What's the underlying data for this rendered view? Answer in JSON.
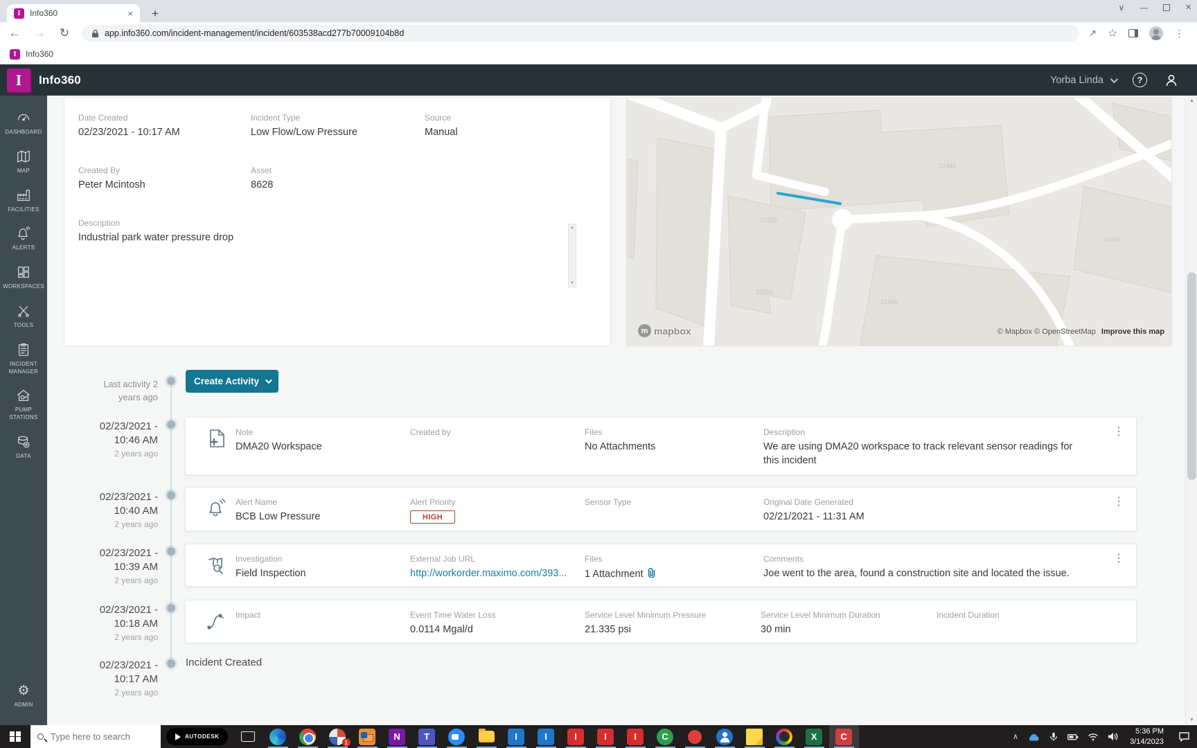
{
  "browser": {
    "tab_title": "Info360",
    "url": "app.info360.com/incident-management/incident/603538acd277b70009104b8d",
    "bookmark": "Info360"
  },
  "header": {
    "app_name": "Info360",
    "location": "Yorba Linda",
    "logo_letter": "I"
  },
  "sidebar": {
    "items": [
      {
        "label": "DASHBOARD",
        "icon": "gauge-icon"
      },
      {
        "label": "MAP",
        "icon": "map-icon"
      },
      {
        "label": "FACILITIES",
        "icon": "factory-icon"
      },
      {
        "label": "ALERTS",
        "icon": "bell-icon"
      },
      {
        "label": "WORKSPACES",
        "icon": "grid-icon"
      },
      {
        "label": "TOOLS",
        "icon": "tools-icon"
      },
      {
        "label": "INCIDENT MANAGER",
        "icon": "clipboard-icon"
      },
      {
        "label": "PUMP STATIONS",
        "icon": "pump-icon"
      },
      {
        "label": "DATA",
        "icon": "database-icon"
      },
      {
        "label": "ADMIN",
        "icon": "gear-icon"
      }
    ]
  },
  "incident": {
    "fields": [
      {
        "label": "Date Created",
        "value": "02/23/2021 - 10:17 AM"
      },
      {
        "label": "Incident Type",
        "value": "Low Flow/Low Pressure"
      },
      {
        "label": "Source",
        "value": "Manual"
      },
      {
        "label": "Created By",
        "value": "Peter Mcintosh"
      },
      {
        "label": "Asset",
        "value": "8628"
      },
      {
        "label": "Description",
        "value": "Industrial park water pressure drop"
      }
    ]
  },
  "map": {
    "logo_text": "mapbox",
    "attribution": "© Mapbox © OpenStreetMap",
    "improve_link": "Improve this map",
    "labels": [
      "22448",
      "22435",
      "22425",
      "22465",
      "22445"
    ],
    "highlight_color": "#2ba7cd"
  },
  "timeline": {
    "last_activity": "Last activity 2 years ago",
    "create_activity_label": "Create Activity",
    "entries": [
      {
        "type": "note",
        "date": "02/23/2021 -",
        "time": "10:46 AM",
        "ago": "2 years ago",
        "fields": [
          {
            "label": "Note",
            "value": "DMA20 Workspace"
          },
          {
            "label": "Created by",
            "value": ""
          },
          {
            "label": "Files",
            "value": "No Attachments"
          },
          {
            "label": "Description",
            "value": "We are using DMA20 workspace to track relevant sensor readings for this incident"
          }
        ]
      },
      {
        "type": "alert",
        "date": "02/23/2021 -",
        "time": "10:40 AM",
        "ago": "2 years ago",
        "fields": [
          {
            "label": "Alert Name",
            "value": "BCB Low Pressure"
          },
          {
            "label": "Alert Priority",
            "value": "HIGH"
          },
          {
            "label": "Sensor Type",
            "value": ""
          },
          {
            "label": "Original Date Generated",
            "value": "02/21/2021 - 11:31 AM"
          }
        ]
      },
      {
        "type": "investigation",
        "date": "02/23/2021 -",
        "time": "10:39 AM",
        "ago": "2 years ago",
        "fields": [
          {
            "label": "Investigation",
            "value": "Field Inspection"
          },
          {
            "label": "External Job URL",
            "value": "http://workorder.maximo.com/393..."
          },
          {
            "label": "Files",
            "value": "1 Attachment"
          },
          {
            "label": "Comments",
            "value": "Joe went to the area, found a construction site and located the issue."
          }
        ]
      },
      {
        "type": "impact",
        "date": "02/23/2021 -",
        "time": "10:18 AM",
        "ago": "2 years ago",
        "fields": [
          {
            "label": "Impact",
            "value": ""
          },
          {
            "label": "Event Time Water Loss",
            "value": "0.0114 Mgal/d"
          },
          {
            "label": "Service Level Minimum Pressure",
            "value": "21.335 psi"
          },
          {
            "label": "Service Level Minimum Duration",
            "value": "30 min"
          },
          {
            "label": "Incident Duration",
            "value": ""
          }
        ]
      },
      {
        "type": "created",
        "date": "02/23/2021 -",
        "time": "10:17 AM",
        "ago": "2 years ago",
        "text": "Incident Created"
      }
    ]
  },
  "taskbar": {
    "search_placeholder": "Type here to search",
    "autodesk_label": "AUTODESK",
    "time": "5:36 PM",
    "date": "3/14/2023",
    "apps": [
      {
        "name": "task-view"
      },
      {
        "name": "edge"
      },
      {
        "name": "chrome"
      },
      {
        "name": "notifications",
        "badge": "1"
      },
      {
        "name": "outlook"
      },
      {
        "name": "onenote",
        "letter": "N"
      },
      {
        "name": "teams",
        "letter": "T"
      },
      {
        "name": "zoom"
      },
      {
        "name": "file-explorer"
      },
      {
        "name": "info360-blue-1",
        "letter": "I"
      },
      {
        "name": "info360-blue-2",
        "letter": "I"
      },
      {
        "name": "info360-red-1",
        "letter": "I"
      },
      {
        "name": "info360-red-2",
        "letter": "I"
      },
      {
        "name": "info360-red-3",
        "letter": "I"
      },
      {
        "name": "camtasia-green",
        "letter": "C"
      },
      {
        "name": "recorder-dot"
      },
      {
        "name": "contacts"
      },
      {
        "name": "sticky-notes"
      },
      {
        "name": "adobe-cc"
      },
      {
        "name": "excel",
        "letter": "X"
      },
      {
        "name": "camtasia",
        "letter": "C",
        "active": true
      }
    ]
  },
  "icons": {
    "close": "×",
    "new_tab": "+",
    "tab_search": "∨",
    "minimize": "—",
    "kebab": "⋮",
    "star": "☆",
    "back": "←",
    "forward": "→",
    "reload": "↻",
    "chevron_up": "∧",
    "caret_up": "▲",
    "caret_down": "▼",
    "gear": "⚙",
    "question": "?",
    "share": "↗"
  },
  "colors": {
    "brand": "#b0188f",
    "header_bg": "#263238",
    "sidebar_bg": "#3e4b52",
    "accent": "#147691",
    "link": "#1b7f9e",
    "high_priority": "#c0392b",
    "map_highlight": "#2ba7cd"
  }
}
